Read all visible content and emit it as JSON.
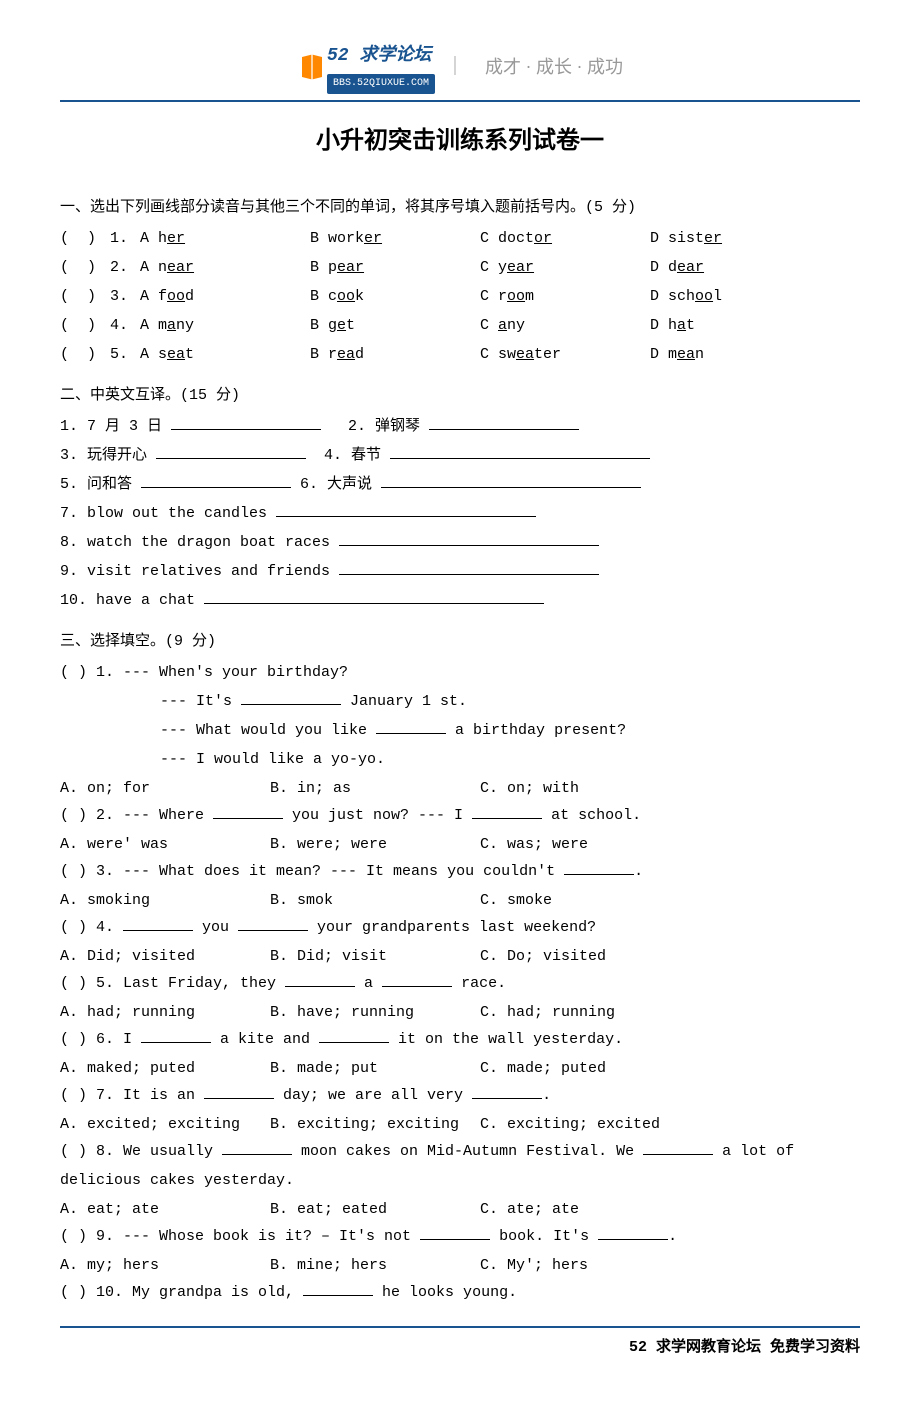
{
  "header": {
    "logo_num": "52",
    "logo_name": "求学论坛",
    "logo_url": "BBS.52QIUXUE.COM",
    "tagline": "成才 · 成长 · 成功"
  },
  "title": "小升初突击训练系列试卷一",
  "section1": {
    "heading": "一、选出下列画线部分读音与其他三个不同的单词，将其序号填入题前括号内。(5 分)",
    "rows": [
      {
        "n": "1.",
        "a_pre": "A h",
        "a_u": "er",
        "a_post": "",
        "b_pre": "B work",
        "b_u": "er",
        "b_post": "",
        "c_pre": "C doct",
        "c_u": "or",
        "c_post": "",
        "d_pre": "D sist",
        "d_u": "er",
        "d_post": ""
      },
      {
        "n": "2.",
        "a_pre": "A n",
        "a_u": "ear",
        "a_post": "",
        "b_pre": "B p",
        "b_u": "ear",
        "b_post": "",
        "c_pre": "C y",
        "c_u": "ear",
        "c_post": "",
        "d_pre": "D d",
        "d_u": "ear",
        "d_post": ""
      },
      {
        "n": "3.",
        "a_pre": "A f",
        "a_u": "oo",
        "a_post": "d",
        "b_pre": "B c",
        "b_u": "oo",
        "b_post": "k",
        "c_pre": "C r",
        "c_u": "oo",
        "c_post": "m",
        "d_pre": "D sch",
        "d_u": "oo",
        "d_post": "l"
      },
      {
        "n": "4.",
        "a_pre": "A m",
        "a_u": "a",
        "a_post": "ny",
        "b_pre": "B g",
        "b_u": "e",
        "b_post": "t",
        "c_pre": "C ",
        "c_u": "a",
        "c_post": "ny",
        "d_pre": "D h",
        "d_u": "a",
        "d_post": "t"
      },
      {
        "n": "5.",
        "a_pre": "A s",
        "a_u": "ea",
        "a_post": "t",
        "b_pre": "B r",
        "b_u": "ea",
        "b_post": "d",
        "c_pre": "C sw",
        "c_u": "ea",
        "c_post": "ter",
        "d_pre": "D m",
        "d_u": "ea",
        "d_post": "n"
      }
    ]
  },
  "section2": {
    "heading": "二、中英文互译。(15 分)",
    "items": {
      "q1": "1. 7 月 3 日",
      "q2": "2. 弹钢琴",
      "q3": "3. 玩得开心",
      "q4": "4. 春节",
      "q5": "5. 问和答",
      "q6": "6. 大声说",
      "q7": "7. blow out the candles",
      "q8": "8. watch the dragon boat races",
      "q9": "9. visit relatives and friends",
      "q10": "10. have a chat"
    }
  },
  "section3": {
    "heading": "三、选择填空。(9 分)",
    "q1": {
      "l1": "(  ) 1. --- When's your birthday?",
      "l2_a": "--- It's ",
      "l2_b": " January 1 st.",
      "l3_a": "--- What would you like ",
      "l3_b": " a birthday present?",
      "l4": "--- I would like a yo-yo.",
      "a": "A. on; for",
      "b": "B. in; as",
      "c": "C. on; with"
    },
    "q2": {
      "l_a": "(  ) 2. --- Where ",
      "l_b": " you just now? --- I ",
      "l_c": " at school.",
      "a": "A. were' was",
      "b": "B. were; were",
      "c": "C. was; were"
    },
    "q3": {
      "l_a": "(  ) 3. --- What does it mean? --- It means you couldn't ",
      "l_b": ".",
      "a": "A. smoking",
      "b": "B. smok",
      "c": "C. smoke"
    },
    "q4": {
      "l_a": "(  ) 4. ",
      "l_b": " you ",
      "l_c": " your grandparents last weekend?",
      "a": "A. Did; visited",
      "b": "B. Did; visit",
      "c": "C. Do; visited"
    },
    "q5": {
      "l_a": "(  ) 5. Last Friday, they ",
      "l_b": " a ",
      "l_c": " race.",
      "a": "A. had; running",
      "b": "B. have; running",
      "c": "C. had; running"
    },
    "q6": {
      "l_a": "(  ) 6. I ",
      "l_b": " a kite and ",
      "l_c": " it on the wall yesterday.",
      "a": "A. maked; puted",
      "b": "B. made; put",
      "c": "C. made; puted"
    },
    "q7": {
      "l_a": "(  ) 7. It is an ",
      "l_b": " day; we are all very ",
      "l_c": ".",
      "a": "A. excited; exciting",
      "b": "B. exciting; exciting",
      "c": "C. exciting; excited"
    },
    "q8": {
      "l_a": "(  ) 8. We usually ",
      "l_b": " moon cakes on Mid-Autumn Festival. We ",
      "l_c": " a lot of",
      "l2": "delicious cakes yesterday.",
      "a": "A. eat; ate",
      "b": "B. eat; eated",
      "c": "C. ate; ate"
    },
    "q9": {
      "l_a": "(  ) 9. --- Whose book is it? – It's not ",
      "l_b": " book. It's ",
      "l_c": ".",
      "a": "A. my; hers",
      "b": "B. mine; hers",
      "c": "C. My'; hers"
    },
    "q10": {
      "l_a": "(  ) 10. My grandpa is old, ",
      "l_b": " he looks young."
    }
  },
  "footer": "52 求学网教育论坛  免费学习资料"
}
